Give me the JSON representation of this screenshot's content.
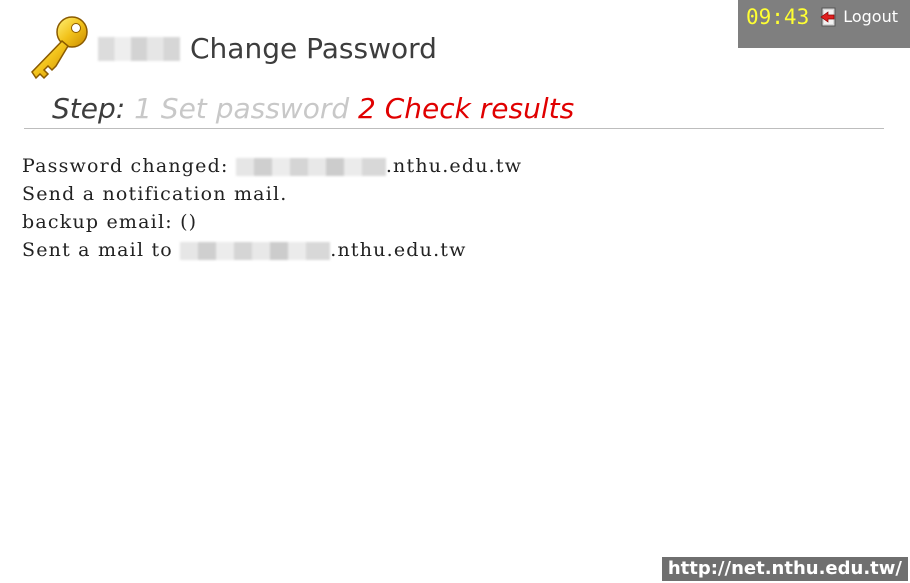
{
  "topbar": {
    "time": "09:43",
    "logout_label": "Logout",
    "logout_icon": "logout-door-icon"
  },
  "header": {
    "icon": "key-icon",
    "title": "Change Password"
  },
  "steps": {
    "label": "Step:",
    "items": [
      {
        "label": "1 Set password",
        "state": "inactive"
      },
      {
        "label": "2 Check results",
        "state": "active"
      }
    ]
  },
  "result": {
    "line1_prefix": "Password changed: ",
    "line1_suffix": ".nthu.edu.tw",
    "line2": "Send a notification mail.",
    "line3": "backup email: ()",
    "line4_prefix": "Sent a mail to ",
    "line4_suffix": ".nthu.edu.tw"
  },
  "footer": {
    "url": "http://net.nthu.edu.tw/"
  },
  "colors": {
    "accent_red": "#e00000",
    "clock_yellow": "#ffff33",
    "topbar_bg": "#7f7f7f",
    "inactive_step": "#c8c8c8"
  }
}
